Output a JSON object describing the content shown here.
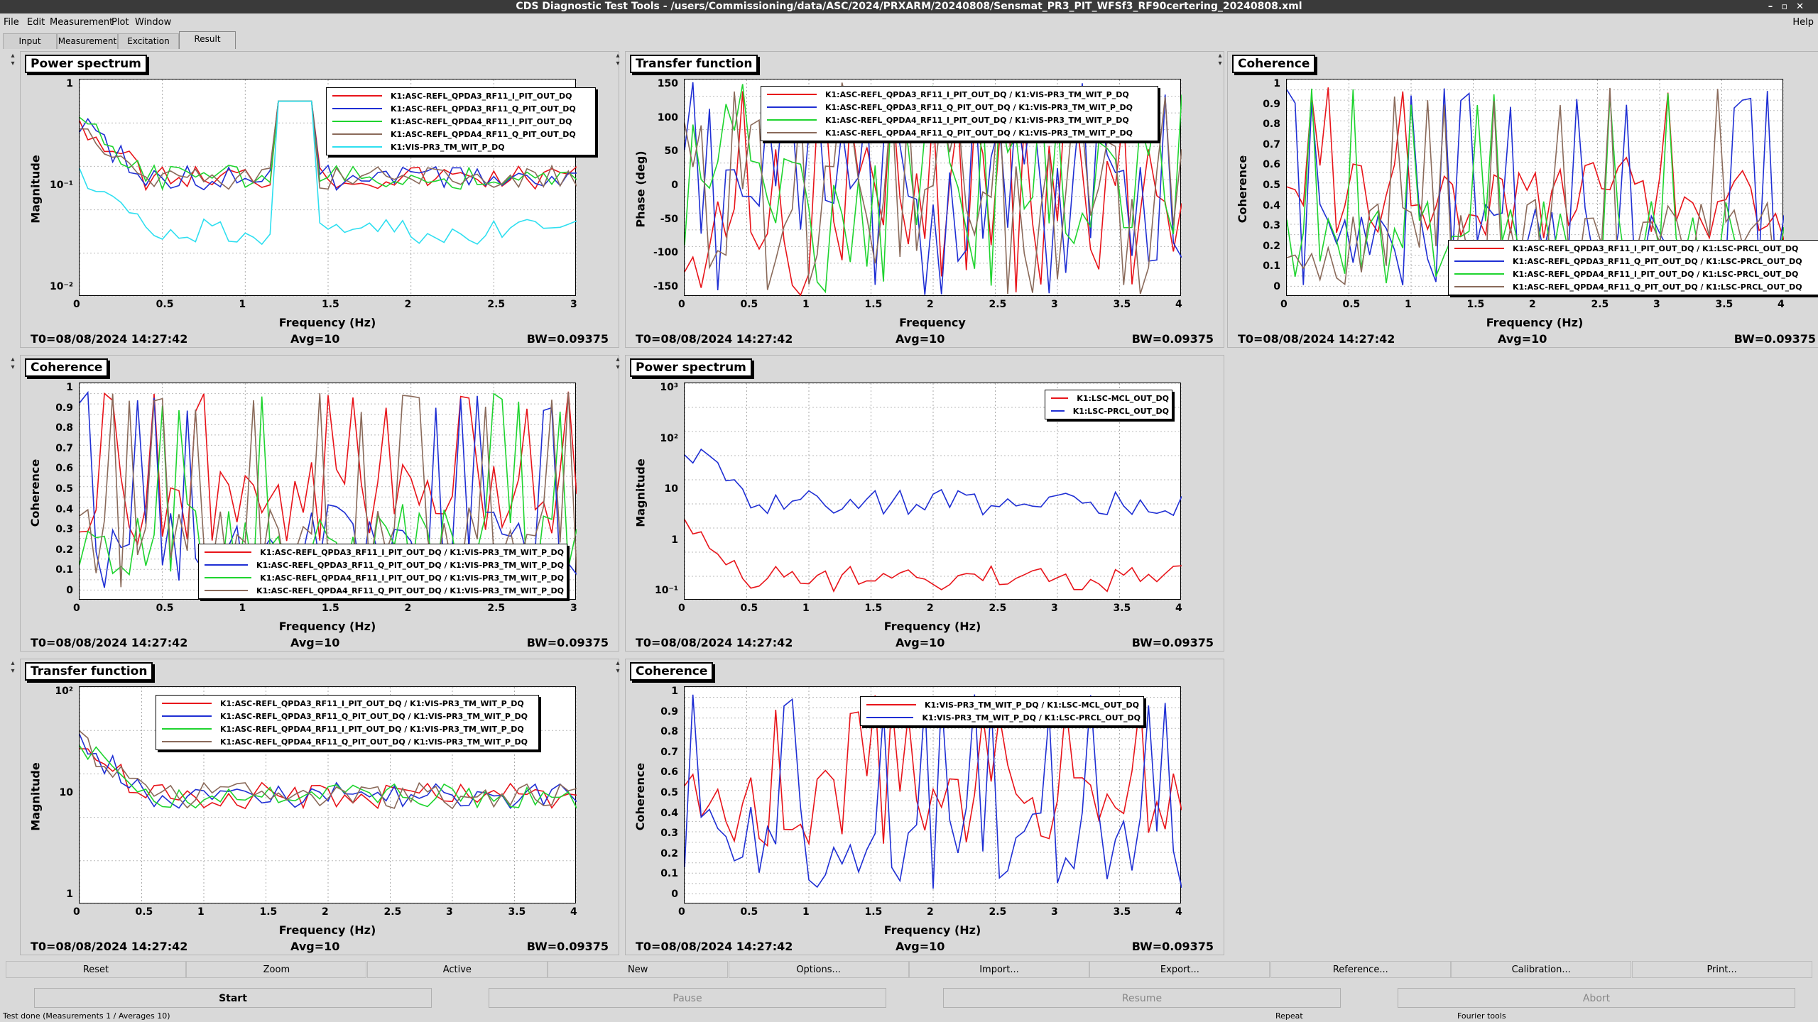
{
  "window": {
    "title": "CDS Diagnostic Test Tools - /users/Commissioning/data/ASC/2024/PRXARM/20240808/Sensmat_PR3_PIT_WFSf3_RF90certering_20240808.xml",
    "help": "Help"
  },
  "menu": [
    "File",
    "Edit",
    "Measurement",
    "Plot",
    "Window"
  ],
  "tabs": [
    "Input",
    "Measurement",
    "Excitation",
    "Result"
  ],
  "panels": [
    {
      "title": "Power spectrum",
      "ylabel": "Magnitude",
      "xlabel": "Frequency (Hz)",
      "yticks": [
        "1",
        "10⁻¹",
        "10⁻²"
      ],
      "xticks": [
        "0",
        "0.5",
        "1",
        "1.5",
        "2",
        "2.5",
        "3"
      ],
      "legend": [
        "K1:ASC-REFL_QPDA3_RF11_I_PIT_OUT_DQ",
        "K1:ASC-REFL_QPDA3_RF11_Q_PIT_OUT_DQ",
        "K1:ASC-REFL_QPDA4_RF11_I_PIT_OUT_DQ",
        "K1:ASC-REFL_QPDA4_RF11_Q_PIT_OUT_DQ",
        "K1:VIS-PR3_TM_WIT_P_DQ"
      ],
      "t0": "T0=08/08/2024 14:27:42",
      "avg": "Avg=10",
      "bw": "BW=0.09375"
    },
    {
      "title": "Transfer function",
      "ylabel": "Phase (deg)",
      "xlabel": "Frequency",
      "yticks": [
        "150",
        "100",
        "50",
        "0",
        "-50",
        "-100",
        "-150"
      ],
      "xticks": [
        "0",
        "0.5",
        "1",
        "1.5",
        "2",
        "2.5",
        "3",
        "3.5",
        "4"
      ],
      "legend": [
        "K1:ASC-REFL_QPDA3_RF11_I_PIT_OUT_DQ / K1:VIS-PR3_TM_WIT_P_DQ",
        "K1:ASC-REFL_QPDA3_RF11_Q_PIT_OUT_DQ / K1:VIS-PR3_TM_WIT_P_DQ",
        "K1:ASC-REFL_QPDA4_RF11_I_PIT_OUT_DQ / K1:VIS-PR3_TM_WIT_P_DQ",
        "K1:ASC-REFL_QPDA4_RF11_Q_PIT_OUT_DQ / K1:VIS-PR3_TM_WIT_P_DQ"
      ],
      "t0": "T0=08/08/2024 14:27:42",
      "avg": "Avg=10",
      "bw": "BW=0.09375"
    },
    {
      "title": "Coherence",
      "ylabel": "Coherence",
      "xlabel": "Frequency (Hz)",
      "yticks": [
        "1",
        "0.9",
        "0.8",
        "0.7",
        "0.6",
        "0.5",
        "0.4",
        "0.3",
        "0.2",
        "0.1",
        "0"
      ],
      "xticks": [
        "0",
        "0.5",
        "1",
        "1.5",
        "2",
        "2.5",
        "3",
        "3.5",
        "4"
      ],
      "legend": [
        "K1:ASC-REFL_QPDA3_RF11_I_PIT_OUT_DQ / K1:LSC-PRCL_OUT_DQ",
        "K1:ASC-REFL_QPDA3_RF11_Q_PIT_OUT_DQ / K1:LSC-PRCL_OUT_DQ",
        "K1:ASC-REFL_QPDA4_RF11_I_PIT_OUT_DQ / K1:LSC-PRCL_OUT_DQ",
        "K1:ASC-REFL_QPDA4_RF11_Q_PIT_OUT_DQ / K1:LSC-PRCL_OUT_DQ"
      ],
      "t0": "T0=08/08/2024 14:27:42",
      "avg": "Avg=10",
      "bw": "BW=0.09375"
    },
    {
      "title": "Coherence",
      "ylabel": "Coherence",
      "xlabel": "Frequency (Hz)",
      "yticks": [
        "1",
        "0.9",
        "0.8",
        "0.7",
        "0.6",
        "0.5",
        "0.4",
        "0.3",
        "0.2",
        "0.1",
        "0"
      ],
      "xticks": [
        "0",
        "0.5",
        "1",
        "1.5",
        "2",
        "2.5",
        "3"
      ],
      "legend": [
        "K1:ASC-REFL_QPDA3_RF11_I_PIT_OUT_DQ / K1:VIS-PR3_TM_WIT_P_DQ",
        "K1:ASC-REFL_QPDA3_RF11_Q_PIT_OUT_DQ / K1:VIS-PR3_TM_WIT_P_DQ",
        "K1:ASC-REFL_QPDA4_RF11_I_PIT_OUT_DQ / K1:VIS-PR3_TM_WIT_P_DQ",
        "K1:ASC-REFL_QPDA4_RF11_Q_PIT_OUT_DQ / K1:VIS-PR3_TM_WIT_P_DQ"
      ],
      "t0": "T0=08/08/2024 14:27:42",
      "avg": "Avg=10",
      "bw": "BW=0.09375"
    },
    {
      "title": "Power spectrum",
      "ylabel": "Magnitude",
      "xlabel": "Frequency (Hz)",
      "yticks": [
        "10³",
        "10²",
        "10",
        "1",
        "10⁻¹"
      ],
      "xticks": [
        "0",
        "0.5",
        "1",
        "1.5",
        "2",
        "2.5",
        "3",
        "3.5",
        "4"
      ],
      "legend": [
        "K1:LSC-MCL_OUT_DQ",
        "K1:LSC-PRCL_OUT_DQ"
      ],
      "t0": "T0=08/08/2024 14:27:42",
      "avg": "Avg=10",
      "bw": "BW=0.09375"
    },
    {
      "title": "Transfer function",
      "ylabel": "Magnitude",
      "xlabel": "Frequency (Hz)",
      "yticks": [
        "10²",
        "10",
        "1"
      ],
      "xticks": [
        "0",
        "0.5",
        "1",
        "1.5",
        "2",
        "2.5",
        "3",
        "3.5",
        "4"
      ],
      "legend": [
        "K1:ASC-REFL_QPDA3_RF11_I_PIT_OUT_DQ / K1:VIS-PR3_TM_WIT_P_DQ",
        "K1:ASC-REFL_QPDA3_RF11_Q_PIT_OUT_DQ / K1:VIS-PR3_TM_WIT_P_DQ",
        "K1:ASC-REFL_QPDA4_RF11_I_PIT_OUT_DQ / K1:VIS-PR3_TM_WIT_P_DQ",
        "K1:ASC-REFL_QPDA4_RF11_Q_PIT_OUT_DQ / K1:VIS-PR3_TM_WIT_P_DQ"
      ],
      "t0": "T0=08/08/2024 14:27:42",
      "avg": "Avg=10",
      "bw": "BW=0.09375"
    },
    {
      "title": "Coherence",
      "ylabel": "Coherence",
      "xlabel": "Frequency (Hz)",
      "yticks": [
        "1",
        "0.9",
        "0.8",
        "0.7",
        "0.6",
        "0.5",
        "0.4",
        "0.3",
        "0.2",
        "0.1",
        "0"
      ],
      "xticks": [
        "0",
        "0.5",
        "1",
        "1.5",
        "2",
        "2.5",
        "3",
        "3.5",
        "4"
      ],
      "legend": [
        "K1:VIS-PR3_TM_WIT_P_DQ / K1:LSC-MCL_OUT_DQ",
        "K1:VIS-PR3_TM_WIT_P_DQ / K1:LSC-PRCL_OUT_DQ"
      ],
      "t0": "T0=08/08/2024 14:27:42",
      "avg": "Avg=10",
      "bw": "BW=0.09375"
    }
  ],
  "colors": {
    "red": "#e8141a",
    "blue": "#1f2fd4",
    "green": "#1fd42f",
    "brown": "#8a6a5a",
    "cyan": "#2fdff0"
  },
  "buttons1": [
    "Reset",
    "Zoom",
    "Active",
    "New",
    "Options...",
    "Import...",
    "Export...",
    "Reference...",
    "Calibration...",
    "Print..."
  ],
  "buttons2": [
    "Start",
    "Pause",
    "Resume",
    "Abort"
  ],
  "statusbar": {
    "left": "Test done (Measurements 1 / Averages 10)",
    "mid": "Repeat",
    "right": "Fourier tools"
  }
}
